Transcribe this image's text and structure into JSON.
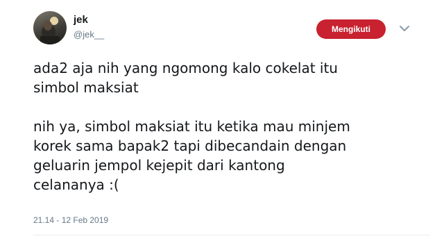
{
  "user": {
    "name": "jek",
    "handle": "@jek__"
  },
  "follow_button": {
    "label": "Mengikuti",
    "color": "#c8212f"
  },
  "menu": {
    "icon": "chevron-down-icon"
  },
  "tweet": {
    "paragraph1": "ada2 aja nih yang ngomong kalo cokelat itu\nsimbol maksiat",
    "paragraph2": "nih ya, simbol maksiat itu ketika mau minjem\nkorek sama bapak2 tapi dibecandain dengan\ngeluarin jempol kejepit dari kantong\ncelananya :(",
    "timestamp": "21.14 - 12 Feb 2019"
  }
}
